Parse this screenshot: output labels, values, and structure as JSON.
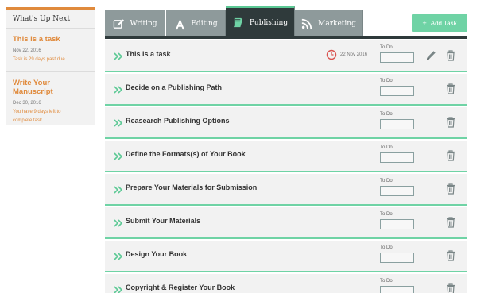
{
  "sidebar": {
    "title": "What's Up Next",
    "items": [
      {
        "title": "This is a task",
        "date": "Nov 22, 2016",
        "note": "Task is 29 days past due"
      },
      {
        "title": "Write Your Manuscript",
        "date": "Dec 30, 2016",
        "note_line1": "You have 9 days left to",
        "note_line2": "complete task"
      }
    ]
  },
  "tabs": [
    {
      "label": "Writing",
      "icon": "pencil-square-icon"
    },
    {
      "label": "Editing",
      "icon": "letter-a-icon"
    },
    {
      "label": "Publishing",
      "icon": "book-icon",
      "active": true
    },
    {
      "label": "Marketing",
      "icon": "rss-icon"
    }
  ],
  "add_task_label": "Add Task",
  "todo_label": "To Do",
  "tasks": [
    {
      "name": "This is a task",
      "due": "22 Nov 2016"
    },
    {
      "name": "Decide on a Publishing Path"
    },
    {
      "name": "Reasearch Publishing Options"
    },
    {
      "name": "Define the Formats(s) of Your Book"
    },
    {
      "name": "Prepare Your Materials for Submission"
    },
    {
      "name": "Submit Your Materials"
    },
    {
      "name": "Design Your Book"
    },
    {
      "name": "Copyright & Register Your Book"
    }
  ],
  "colors": {
    "accent_green": "#6fd3a5",
    "accent_orange": "#e08a3c",
    "tab_dark": "#2f3a3b",
    "tab_gray": "#8e9a9b",
    "overdue_red": "#d9534f"
  }
}
